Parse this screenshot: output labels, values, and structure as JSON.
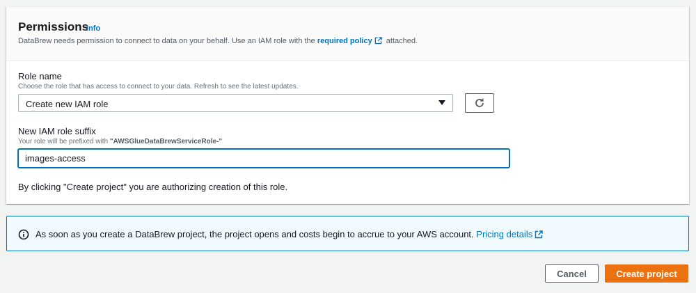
{
  "header": {
    "title": "Permissions",
    "info_label": "Info",
    "description_prefix": "DataBrew needs permission to connect to data on your behalf. Use an IAM role with the",
    "policy_link": "required policy",
    "description_suffix": "attached."
  },
  "role_name": {
    "label": "Role name",
    "description": "Choose the role that has access to connect to your data. Refresh to see the latest updates.",
    "selected_value": "Create new IAM role"
  },
  "role_suffix": {
    "label": "New IAM role suffix",
    "description_prefix": "Your role will be prefixed with",
    "prefix_value": "\"AWSGlueDataBrewServiceRole-\"",
    "value": "images-access"
  },
  "authorization_note": "By clicking \"Create project\" you are authorizing creation of this role.",
  "alert": {
    "text": "As soon as you create a DataBrew project, the project opens and costs begin to accrue to your AWS account.",
    "link": "Pricing details"
  },
  "footer": {
    "cancel_label": "Cancel",
    "create_label": "Create project"
  },
  "colors": {
    "link": "#0073bb",
    "primary_button": "#ec7211",
    "alert_background": "#f1faff"
  },
  "icons": {
    "external_link": "external-link-icon",
    "refresh": "refresh-icon",
    "info": "info-circle-icon",
    "dropdown": "caret-down-icon"
  }
}
